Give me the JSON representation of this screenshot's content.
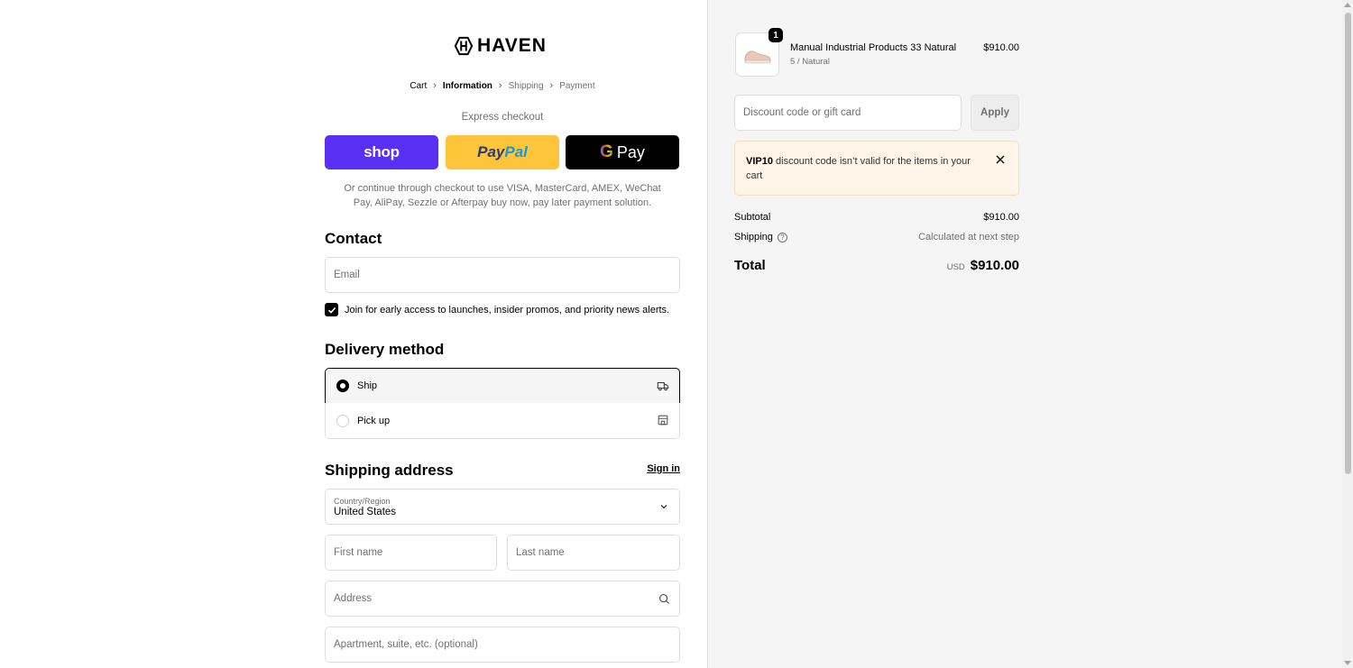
{
  "brand": {
    "name": "HAVEN",
    "logo_icon": "haven-hex-logo"
  },
  "breadcrumb": [
    {
      "label": "Cart"
    },
    {
      "label": "Information",
      "active": true
    },
    {
      "label": "Shipping"
    },
    {
      "label": "Payment"
    }
  ],
  "express": {
    "title": "Express checkout",
    "shop_label": "shop",
    "paypal_label_1": "Pay",
    "paypal_label_2": "Pal",
    "gpay_g": "G",
    "gpay_label": "Pay",
    "note": "Or continue through checkout to use VISA, MasterCard, AMEX, WeChat Pay, AliPay, Sezzle or Afterpay buy now, pay later payment solution."
  },
  "contact": {
    "title": "Contact",
    "sign_in": "Sign in",
    "email_placeholder": "Email",
    "newsletter_label": "Join for early access to launches, insider promos, and priority news alerts.",
    "newsletter_checked": true
  },
  "delivery": {
    "title": "Delivery method",
    "options": [
      {
        "label": "Ship",
        "selected": true,
        "icon": "truck-icon"
      },
      {
        "label": "Pick up",
        "selected": false,
        "icon": "store-icon"
      }
    ]
  },
  "shipping_address": {
    "title": "Shipping address",
    "country_label": "Country/Region",
    "country_value": "United States",
    "first_name_placeholder": "First name",
    "last_name_placeholder": "Last name",
    "address_placeholder": "Address",
    "apartment_placeholder": "Apartment, suite, etc. (optional)"
  },
  "summary": {
    "product": {
      "name": "Manual Industrial Products 33 Natural",
      "variant": "5 / Natural",
      "price": "$910.00",
      "quantity": "1"
    },
    "discount_placeholder": "Discount code or gift card",
    "apply_label": "Apply",
    "alert_code": "VIP10",
    "alert_text": " discount code isn’t valid for the items in your cart",
    "subtotal_label": "Subtotal",
    "subtotal_value": "$910.00",
    "shipping_label": "Shipping",
    "shipping_value": "Calculated at next step",
    "total_label": "Total",
    "total_currency": "USD",
    "total_value": "$910.00"
  },
  "colors": {
    "shop_pay": "#5a31f4",
    "paypal": "#ffc439",
    "gpay": "#000000",
    "alert_bg": "#fff4e8",
    "summary_bg": "#f5f5f5"
  }
}
